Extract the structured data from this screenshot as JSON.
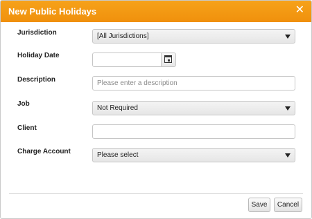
{
  "dialog": {
    "title": "New Public Holidays",
    "close_icon": "close-icon",
    "close_glyph": "✕"
  },
  "form": {
    "jurisdiction": {
      "label": "Jurisdiction",
      "value": "[All Jurisdictions]"
    },
    "holiday_date": {
      "label": "Holiday Date",
      "value": "",
      "icon": "calendar-icon"
    },
    "description": {
      "label": "Description",
      "value": "",
      "placeholder": "Please enter a description"
    },
    "job": {
      "label": "Job",
      "value": "Not Required"
    },
    "client": {
      "label": "Client",
      "value": ""
    },
    "charge_account": {
      "label": "Charge Account",
      "value": "Please select"
    }
  },
  "buttons": {
    "save": "Save",
    "cancel": "Cancel"
  },
  "colors": {
    "titlebar": "#f0900c",
    "title_text": "#ffffff"
  }
}
